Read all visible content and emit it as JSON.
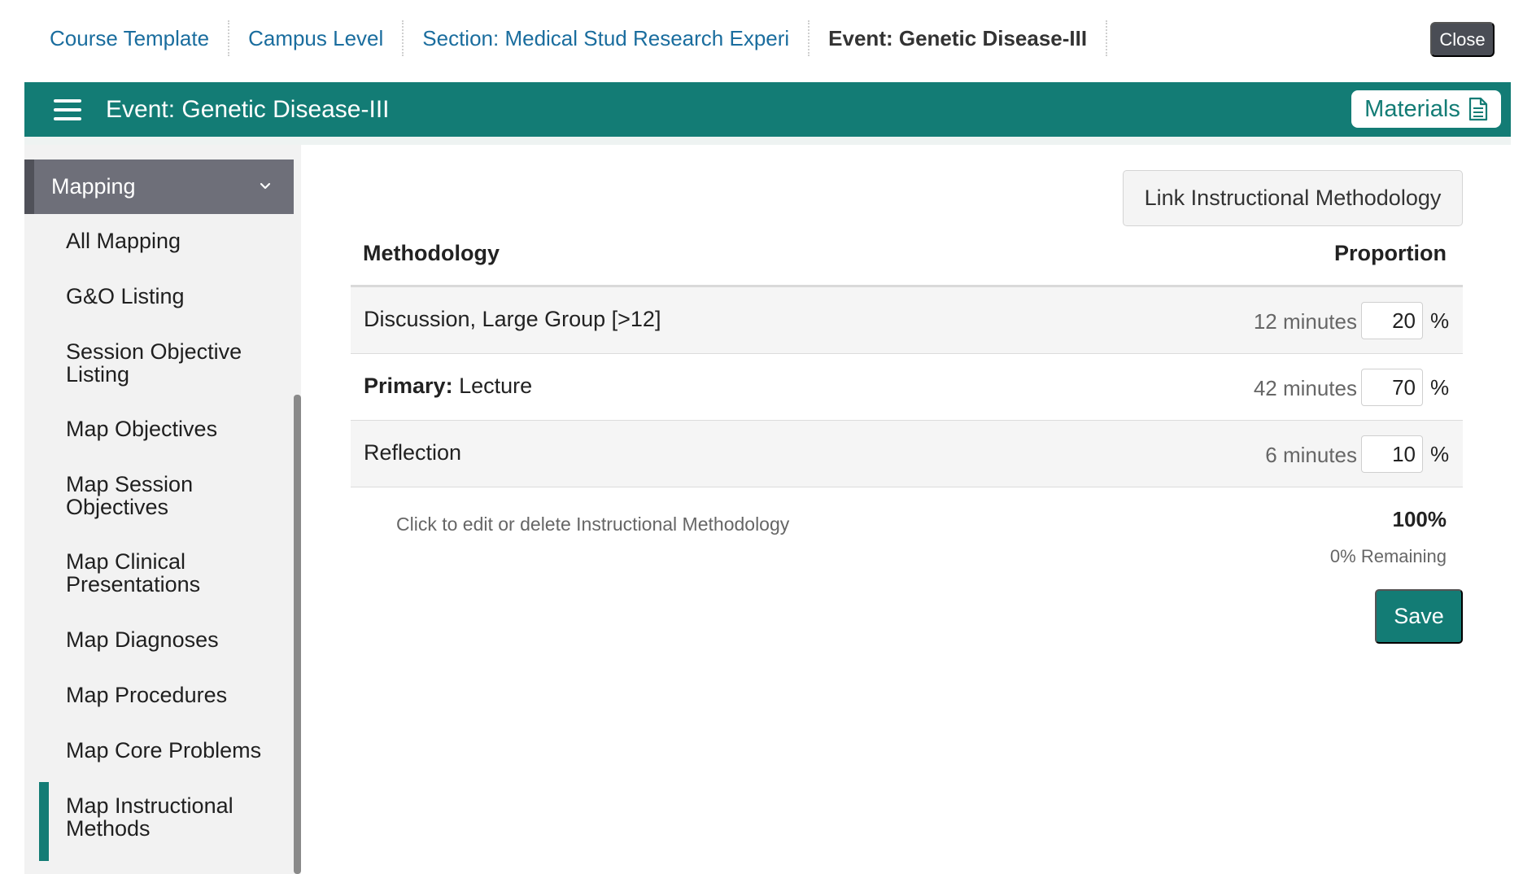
{
  "breadcrumb": {
    "items": [
      "Course Template",
      "Campus Level",
      "Section: Medical Stud Research Experi",
      "Event: Genetic Disease-III"
    ]
  },
  "close_label": "Close",
  "header": {
    "title": "Event: Genetic Disease-III",
    "materials_label": "Materials",
    "accent_color": "#137c75"
  },
  "sidebar": {
    "section_label": "Mapping",
    "items": [
      {
        "label": "All Mapping"
      },
      {
        "label": "G&O Listing"
      },
      {
        "label": "Session Objective Listing"
      },
      {
        "label": "Map Objectives"
      },
      {
        "label": "Map Session Objectives"
      },
      {
        "label": "Map Clinical Presentations"
      },
      {
        "label": "Map Diagnoses"
      },
      {
        "label": "Map Procedures"
      },
      {
        "label": "Map Core Problems"
      },
      {
        "label": "Map Instructional Methods"
      }
    ],
    "active_item": "Map Instructional Methods"
  },
  "main": {
    "link_button_label": "Link Instructional Methodology",
    "columns": [
      "Methodology",
      "Proportion"
    ],
    "rows": [
      {
        "prefix": "",
        "label": "Discussion, Large Group [>12]",
        "minutes": "12 minutes",
        "percent": "20",
        "unit": "%"
      },
      {
        "prefix": "Primary:",
        "label": " Lecture",
        "minutes": "42 minutes",
        "percent": "70",
        "unit": "%"
      },
      {
        "prefix": "",
        "label": "Reflection",
        "minutes": "6 minutes",
        "percent": "10",
        "unit": "%"
      }
    ],
    "hint": "Click to edit or delete Instructional Methodology",
    "total": "100%",
    "remaining": "0% Remaining",
    "save_label": "Save"
  }
}
